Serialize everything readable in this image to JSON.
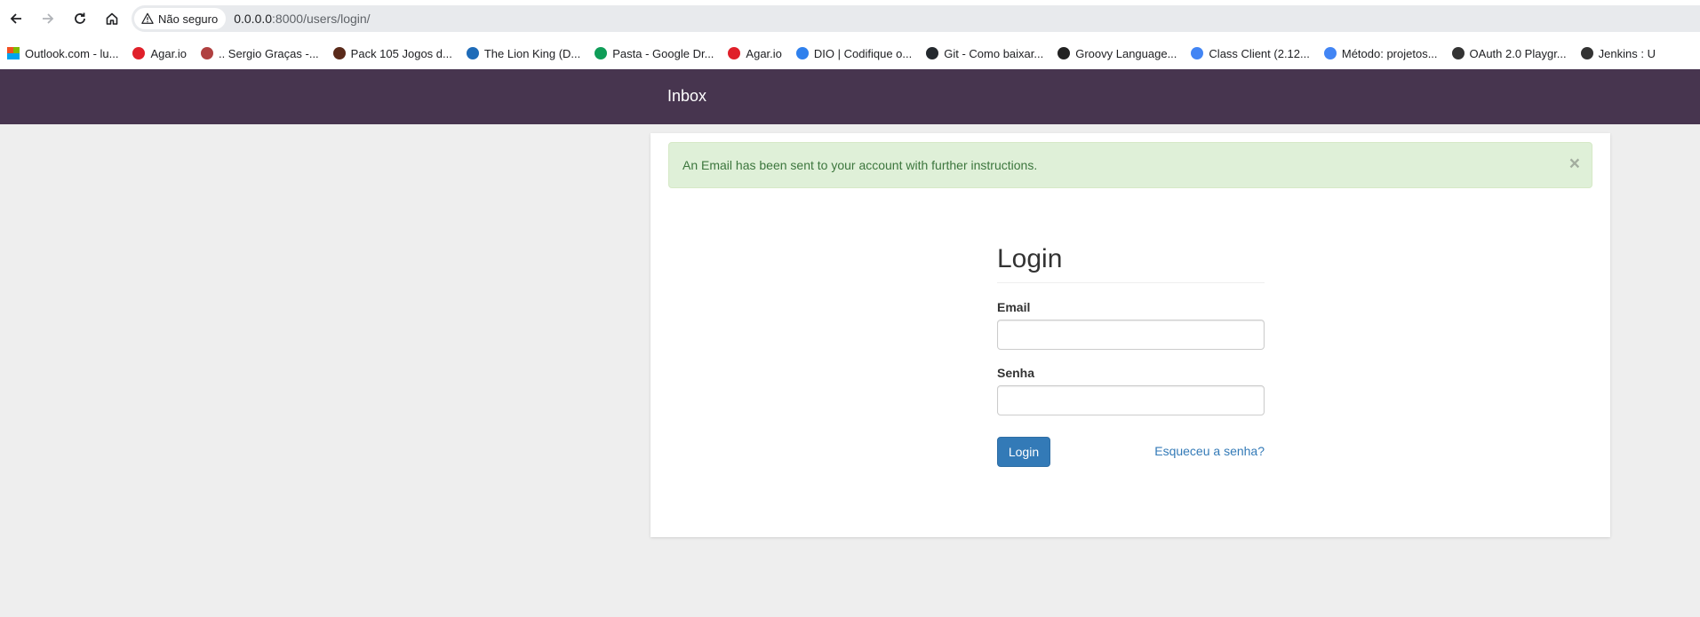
{
  "browser": {
    "security_label": "Não seguro",
    "url_host": "0.0.0.0",
    "url_rest": ":8000/users/login/",
    "bookmarks": [
      {
        "label": "Outlook.com - lu...",
        "icon": "microsoft-icon",
        "color": "#f25022"
      },
      {
        "label": "Agar.io",
        "icon": "agar-icon",
        "color": "#e0202a"
      },
      {
        "label": ".. Sergio Graças -...",
        "icon": "sergio-icon",
        "color": "#b04040"
      },
      {
        "label": "Pack 105 Jogos d...",
        "icon": "pack-icon",
        "color": "#5a2a1a"
      },
      {
        "label": "The Lion King (D...",
        "icon": "lion-king-icon",
        "color": "#1e6bb8"
      },
      {
        "label": "Pasta - Google Dr...",
        "icon": "google-drive-icon",
        "color": "#0f9d58"
      },
      {
        "label": "Agar.io",
        "icon": "agar-icon",
        "color": "#e0202a"
      },
      {
        "label": "DIO | Codifique o...",
        "icon": "dio-icon",
        "color": "#2f80ed"
      },
      {
        "label": "Git - Como baixar...",
        "icon": "github-icon",
        "color": "#24292e"
      },
      {
        "label": "Groovy Language...",
        "icon": "groovy-icon",
        "color": "#222222"
      },
      {
        "label": "Class Client (2.12...",
        "icon": "google-cloud-icon",
        "color": "#4285f4"
      },
      {
        "label": "Método: projetos...",
        "icon": "google-cloud-icon",
        "color": "#4285f4"
      },
      {
        "label": "OAuth 2.0 Playgr...",
        "icon": "oauth-icon",
        "color": "#333333"
      },
      {
        "label": "Jenkins : U",
        "icon": "jenkins-icon",
        "color": "#333333"
      }
    ]
  },
  "navbar": {
    "brand": "Inbox",
    "bg_color": "#47354f"
  },
  "alert": {
    "message": "An Email has been sent to your account with further instructions.",
    "close_symbol": "×",
    "color": "#dff0d8"
  },
  "login": {
    "title": "Login",
    "email_label": "Email",
    "email_value": "",
    "password_label": "Senha",
    "password_value": "",
    "submit_label": "Login",
    "forgot_label": "Esqueceu a senha?",
    "accent_color": "#337ab7"
  }
}
